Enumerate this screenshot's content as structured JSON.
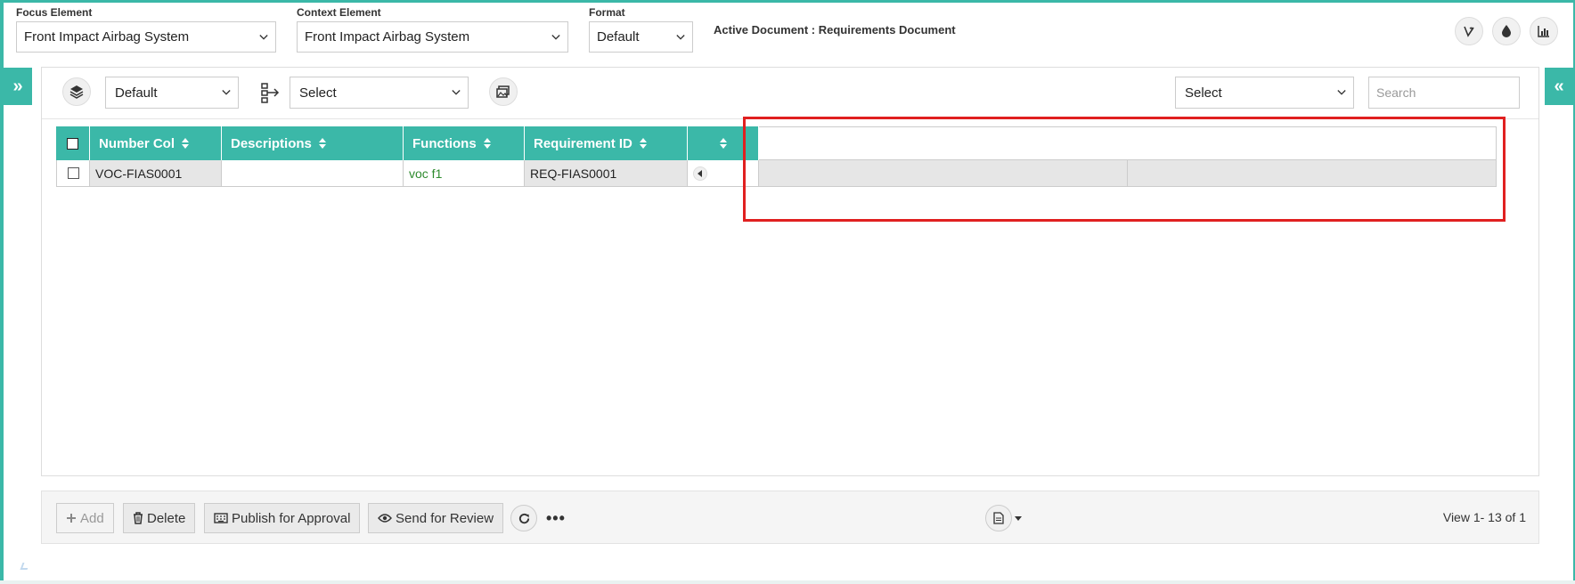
{
  "header": {
    "focus_label": "Focus Element",
    "focus_value": "Front Impact Airbag System",
    "context_label": "Context Element",
    "context_value": "Front Impact Airbag System",
    "format_label": "Format",
    "format_value": "Default",
    "active_document": "Active Document : Requirements Document",
    "icons": [
      "vine-icon",
      "drop-icon",
      "chart-icon"
    ]
  },
  "toolbar": {
    "layer_select_value": "Default",
    "hierarchy_select_value": "Select",
    "right_select_value": "Select",
    "search_placeholder": "Search"
  },
  "grid": {
    "columns": [
      "Number Col",
      "Descriptions",
      "Functions",
      "Requirement ID",
      ""
    ],
    "rows": [
      {
        "number": "VOC-FIAS0001",
        "description": "",
        "function": "voc f1",
        "requirement_id": "REQ-FIAS0001"
      }
    ]
  },
  "footer": {
    "add_label": "Add",
    "delete_label": "Delete",
    "publish_label": "Publish for Approval",
    "review_label": "Send for Review",
    "more_label": "•••",
    "view_text": "View 1- 13 of 1"
  },
  "colors": {
    "accent": "#3bb8a8",
    "highlight": "#e02020",
    "function_text": "#2e8b2e"
  }
}
